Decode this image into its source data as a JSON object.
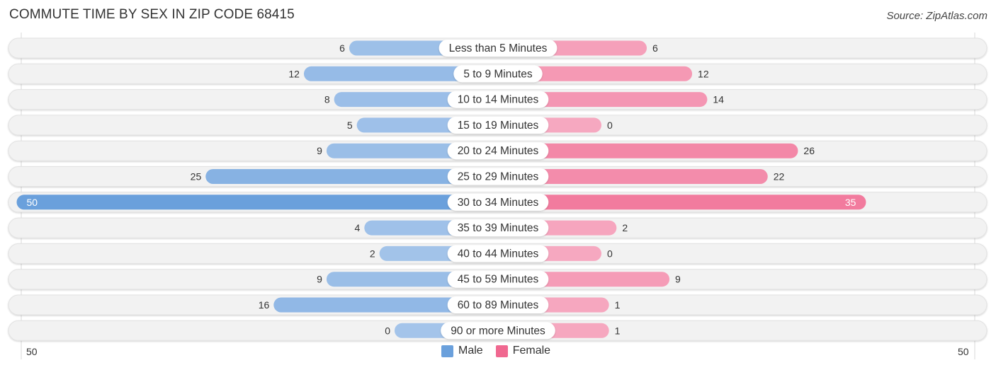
{
  "title": "COMMUTE TIME BY SEX IN ZIP CODE 68415",
  "source": "Source: ZipAtlas.com",
  "colors": {
    "male": "#6aa0dc",
    "male_light": "#a4c4ea",
    "female": "#f06890",
    "female_light": "#f6a8c0",
    "row_bg": "#f2f2f2",
    "label_bg": "#ffffff",
    "text": "#333333"
  },
  "chart_data": {
    "type": "bar",
    "orientation": "diverging-horizontal",
    "title": "COMMUTE TIME BY SEX IN ZIP CODE 68415",
    "categories": [
      "Less than 5 Minutes",
      "5 to 9 Minutes",
      "10 to 14 Minutes",
      "15 to 19 Minutes",
      "20 to 24 Minutes",
      "25 to 29 Minutes",
      "30 to 34 Minutes",
      "35 to 39 Minutes",
      "40 to 44 Minutes",
      "45 to 59 Minutes",
      "60 to 89 Minutes",
      "90 or more Minutes"
    ],
    "series": [
      {
        "name": "Male",
        "side": "left",
        "values": [
          6,
          12,
          8,
          5,
          9,
          25,
          50,
          4,
          2,
          9,
          16,
          0
        ]
      },
      {
        "name": "Female",
        "side": "right",
        "values": [
          6,
          12,
          14,
          0,
          26,
          22,
          35,
          2,
          0,
          9,
          1,
          1
        ]
      }
    ],
    "xlim": [
      -50,
      50
    ],
    "axis_ticks": {
      "left": "50",
      "right": "50"
    },
    "legend": {
      "position": "bottom-center",
      "entries": [
        "Male",
        "Female"
      ]
    }
  }
}
